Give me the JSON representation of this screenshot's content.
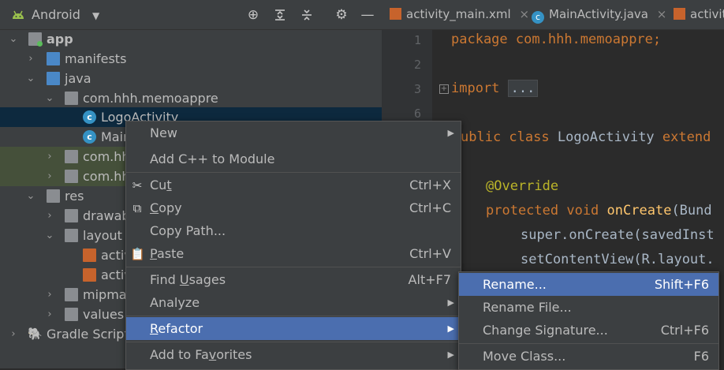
{
  "toolbar": {
    "view_selector": "Android",
    "icons": [
      "locate-icon",
      "expand-all-icon",
      "collapse-all-icon",
      "settings-gear-icon",
      "hide-panel-icon"
    ]
  },
  "tree": [
    {
      "label": "app",
      "level": 0,
      "icon": "module-folder-icon",
      "expanded": true
    },
    {
      "label": "manifests",
      "level": 1,
      "icon": "folder-icon",
      "expanded": false
    },
    {
      "label": "java",
      "level": 1,
      "icon": "folder-icon",
      "expanded": true
    },
    {
      "label": "com.hhh.memoappre",
      "level": 2,
      "icon": "package-icon",
      "expanded": true
    },
    {
      "label": "LogoActivity",
      "level": 3,
      "icon": "class-icon",
      "selected": true
    },
    {
      "label": "Main",
      "level": 3,
      "icon": "class-icon"
    },
    {
      "label": "com.hh",
      "level": 2,
      "icon": "package-icon",
      "expanded": false
    },
    {
      "label": "com.hh",
      "level": 2,
      "icon": "package-icon",
      "expanded": false
    },
    {
      "label": "res",
      "level": 1,
      "icon": "res-folder-icon",
      "expanded": true
    },
    {
      "label": "drawab",
      "level": 2,
      "icon": "folder-icon",
      "expanded": false
    },
    {
      "label": "layout",
      "level": 2,
      "icon": "folder-icon",
      "expanded": true
    },
    {
      "label": "activ",
      "level": 3,
      "icon": "xml-file-icon"
    },
    {
      "label": "activ",
      "level": 3,
      "icon": "xml-file-icon"
    },
    {
      "label": "mipmap",
      "level": 2,
      "icon": "folder-icon",
      "expanded": false
    },
    {
      "label": "values",
      "level": 2,
      "icon": "folder-icon",
      "expanded": false
    },
    {
      "label": "Gradle Scripts",
      "level": 0,
      "icon": "gradle-icon",
      "expanded": false
    }
  ],
  "editor_tabs": [
    "activity_main.xml",
    "MainActivity.java",
    "activit"
  ],
  "code": {
    "line_numbers": [
      "1",
      "2",
      "3",
      "6"
    ],
    "package_kw": "package",
    "package_name": "com.hhh.memoappre",
    "package_semi": ";",
    "import_kw": "import",
    "import_fold": "...",
    "class_kw": "ublic class",
    "class_name": "LogoActivity",
    "extends_kw": "extend",
    "annotation": "@Override",
    "method_mods": "protected void",
    "method_name": "onCreate",
    "method_rest": "(Bund",
    "super_line": "super.onCreate(savedInst",
    "content_line": "setContentView(R.layout."
  },
  "context_menu": {
    "items": [
      {
        "label": "New",
        "submenu": true
      },
      {
        "label": "Add C++ to Module"
      },
      {
        "label": "Cut",
        "mn": "t",
        "pre": "Cu",
        "post": "",
        "shortcut": "Ctrl+X",
        "icon": "cut-icon"
      },
      {
        "label": "Copy",
        "mn": "C",
        "pre": "",
        "post": "opy",
        "shortcut": "Ctrl+C",
        "icon": "copy-icon"
      },
      {
        "label": "Copy Path..."
      },
      {
        "label": "Paste",
        "mn": "P",
        "pre": "",
        "post": "aste",
        "shortcut": "Ctrl+V",
        "icon": "paste-icon"
      },
      {
        "label": "Find Usages",
        "mn": "U",
        "pre": "Find ",
        "post": "sages",
        "shortcut": "Alt+F7"
      },
      {
        "label": "Analyze",
        "submenu": true
      },
      {
        "label": "Refactor",
        "mn": "R",
        "pre": "",
        "post": "efactor",
        "submenu": true,
        "selected": true
      },
      {
        "label": "Add to Favorites",
        "mn": "v",
        "pre": "Add to Fa",
        "post": "orites",
        "submenu": true
      }
    ]
  },
  "refactor_submenu": {
    "items": [
      {
        "label": "Rename...",
        "shortcut": "Shift+F6",
        "selected": true
      },
      {
        "label": "Rename File..."
      },
      {
        "label": "Change Signature...",
        "shortcut": "Ctrl+F6"
      },
      {
        "label": "Move Class...",
        "shortcut": "F6"
      }
    ]
  },
  "colors": {
    "selection": "#4b6eaf",
    "panel_bg": "#3c3f41",
    "editor_bg": "#2b2b2b",
    "keyword": "#cc7832",
    "annotation": "#bbb529",
    "function": "#ffc66d"
  }
}
